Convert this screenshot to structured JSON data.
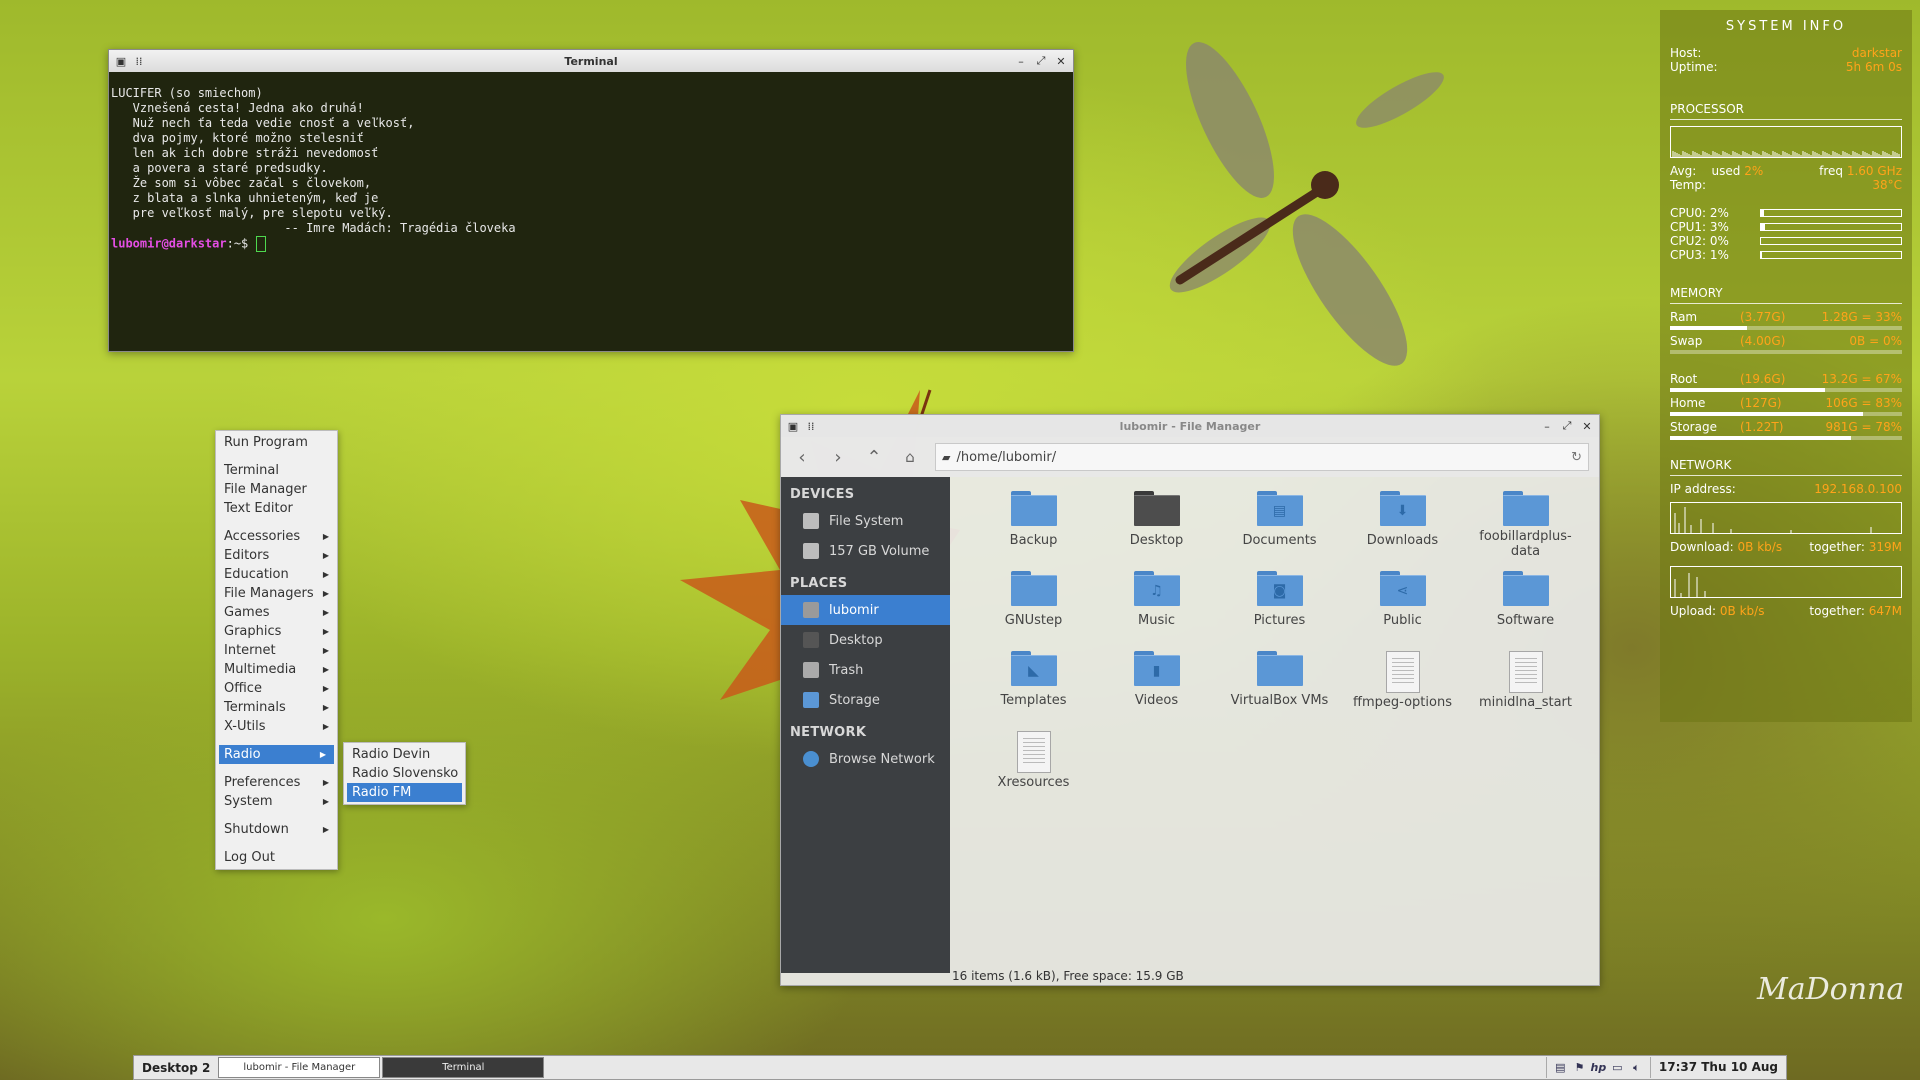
{
  "terminal": {
    "title": "Terminal",
    "lines": [
      "LUCIFER (so smiechom)",
      "",
      "   Vznešená cesta! Jedna ako druhá!",
      "   Nuž nech ťa teda vedie cnosť a veľkosť,",
      "   dva pojmy, ktoré možno stelesniť",
      "   len ak ich dobre stráži nevedomosť",
      "   a povera a staré predsudky.",
      "   Že som si vôbec začal s človekom,",
      "   z blata a slnka uhnieteným, keď je",
      "   pre veľkosť malý, pre slepotu veľký.",
      "",
      "                        -- Imre Madách: Tragédia človeka",
      ""
    ],
    "prompt_user": "lubomir@darkstar",
    "prompt_rest": ":~$ "
  },
  "menu": {
    "groups": [
      [
        {
          "label": "Run Program"
        }
      ],
      [
        {
          "label": "Terminal"
        },
        {
          "label": "File Manager"
        },
        {
          "label": "Text Editor"
        }
      ],
      [
        {
          "label": "Accessories",
          "sub": true
        },
        {
          "label": "Editors",
          "sub": true
        },
        {
          "label": "Education",
          "sub": true
        },
        {
          "label": "File Managers",
          "sub": true
        },
        {
          "label": "Games",
          "sub": true
        },
        {
          "label": "Graphics",
          "sub": true
        },
        {
          "label": "Internet",
          "sub": true
        },
        {
          "label": "Multimedia",
          "sub": true
        },
        {
          "label": "Office",
          "sub": true
        },
        {
          "label": "Terminals",
          "sub": true
        },
        {
          "label": "X-Utils",
          "sub": true
        }
      ],
      [
        {
          "label": "Radio",
          "sub": true,
          "active": true
        }
      ],
      [
        {
          "label": "Preferences",
          "sub": true
        },
        {
          "label": "System",
          "sub": true
        }
      ],
      [
        {
          "label": "Shutdown",
          "sub": true
        }
      ],
      [
        {
          "label": "Log Out"
        }
      ]
    ],
    "radio_submenu": [
      {
        "label": "Radio Devin"
      },
      {
        "label": "Radio Slovensko"
      },
      {
        "label": "Radio FM",
        "active": true
      }
    ]
  },
  "file_manager": {
    "title": "lubomir - File Manager",
    "path": "/home/lubomir/",
    "sidebar": [
      {
        "heading": "DEVICES",
        "items": [
          {
            "label": "File System",
            "icon": "drive-icon"
          },
          {
            "label": "157 GB Volume",
            "icon": "drive-icon"
          }
        ]
      },
      {
        "heading": "PLACES",
        "items": [
          {
            "label": "lubomir",
            "icon": "home-icon",
            "selected": true
          },
          {
            "label": "Desktop",
            "icon": "desktop-icon"
          },
          {
            "label": "Trash",
            "icon": "trash-icon"
          },
          {
            "label": "Storage",
            "icon": "folder-icon"
          }
        ]
      },
      {
        "heading": "NETWORK",
        "items": [
          {
            "label": "Browse Network",
            "icon": "network-icon"
          }
        ]
      }
    ],
    "items": [
      {
        "label": "Backup",
        "type": "folder",
        "glyph": ""
      },
      {
        "label": "Desktop",
        "type": "folder-dark",
        "glyph": ""
      },
      {
        "label": "Documents",
        "type": "folder",
        "glyph": "▤"
      },
      {
        "label": "Downloads",
        "type": "folder",
        "glyph": "⬇"
      },
      {
        "label": "foobillardplus-data",
        "type": "folder",
        "glyph": ""
      },
      {
        "label": "GNUstep",
        "type": "folder",
        "glyph": ""
      },
      {
        "label": "Music",
        "type": "folder",
        "glyph": "♫"
      },
      {
        "label": "Pictures",
        "type": "folder",
        "glyph": "◙"
      },
      {
        "label": "Public",
        "type": "folder",
        "glyph": "⋖"
      },
      {
        "label": "Software",
        "type": "folder",
        "glyph": ""
      },
      {
        "label": "Templates",
        "type": "folder",
        "glyph": "◣"
      },
      {
        "label": "Videos",
        "type": "folder",
        "glyph": "▮"
      },
      {
        "label": "VirtualBox VMs",
        "type": "folder",
        "glyph": ""
      },
      {
        "label": "ffmpeg-options",
        "type": "file",
        "glyph": ""
      },
      {
        "label": "minidlna_start",
        "type": "file",
        "glyph": ""
      },
      {
        "label": "Xresources",
        "type": "file",
        "glyph": ""
      }
    ],
    "status": "16 items (1.6 kB), Free space: 15.9 GB"
  },
  "conky": {
    "title": "SYSTEM INFO",
    "host_label": "Host:",
    "host": "darkstar",
    "uptime_label": "Uptime:",
    "uptime": "5h 6m 0s",
    "processor": {
      "heading": "PROCESSOR",
      "avg_label": "Avg:",
      "used_label": "used",
      "used": "2%",
      "freq_label": "freq",
      "freq": "1.60 GHz",
      "temp_label": "Temp:",
      "temp": "38°C",
      "cpus": [
        {
          "label": "CPU0: 2%",
          "value": 0.02
        },
        {
          "label": "CPU1: 3%",
          "value": 0.03
        },
        {
          "label": "CPU2: 0%",
          "value": 0.0
        },
        {
          "label": "CPU3: 1%",
          "value": 0.01
        }
      ]
    },
    "memory": {
      "heading": "MEMORY",
      "rows": [
        {
          "label": "Ram",
          "total": "(3.77G)",
          "used": "1.28G = 33%",
          "value": 0.33
        },
        {
          "label": "Swap",
          "total": "(4.00G)",
          "used": "0B = 0%",
          "value": 0.0
        },
        {
          "label": "Root",
          "total": "(19.6G)",
          "used": "13.2G = 67%",
          "value": 0.67
        },
        {
          "label": "Home",
          "total": "(127G)",
          "used": "106G = 83%",
          "value": 0.83
        },
        {
          "label": "Storage",
          "total": "(1.22T)",
          "used": "981G = 78%",
          "value": 0.78
        }
      ]
    },
    "network": {
      "heading": "NETWORK",
      "ip_label": "IP address:",
      "ip": "192.168.0.100",
      "download_label": "Download:",
      "download": "0B kb/s",
      "down_together_label": "together:",
      "down_together": "319M",
      "upload_label": "Upload:",
      "upload": "0B kb/s",
      "up_together_label": "together:",
      "up_together": "647M"
    }
  },
  "taskbar": {
    "desktop": "Desktop 2",
    "tasks": [
      "lubomir - File Manager",
      "Terminal"
    ],
    "clock": "17:37 Thu 10 Aug"
  },
  "signature": "MaDonna",
  "colors": {
    "accent": "#3b7fd0",
    "conky_value": "#ffa31a",
    "terminal_bg": "#20250f"
  }
}
